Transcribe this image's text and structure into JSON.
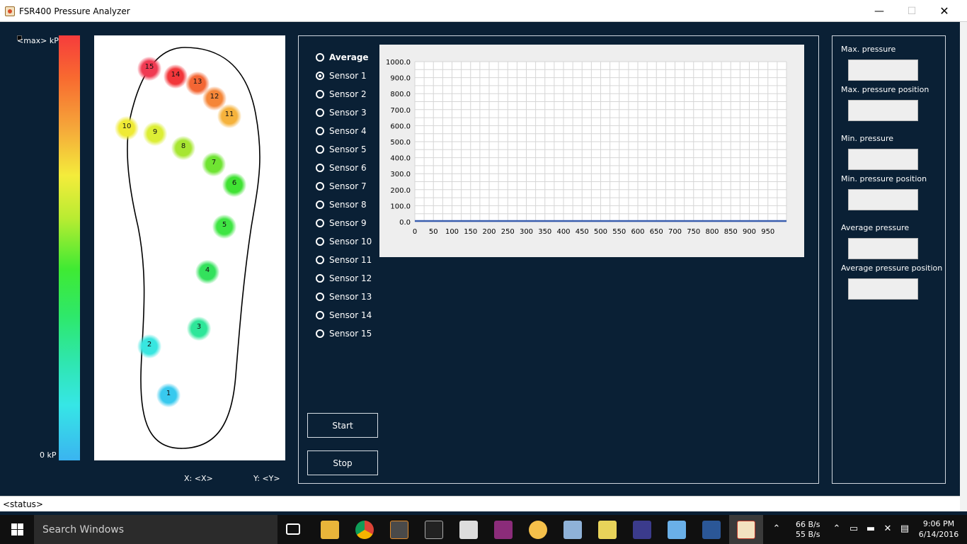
{
  "window": {
    "title": "FSR400 Pressure Analyzer",
    "minimize": "—",
    "maximize": "☐",
    "close": "✕"
  },
  "scale": {
    "max_label": "<max>  kP",
    "min_label": "0 kP"
  },
  "foot": {
    "sensors": [
      {
        "id": "1",
        "color": "#38c9ee"
      },
      {
        "id": "2",
        "color": "#38e6e0"
      },
      {
        "id": "3",
        "color": "#2ee699"
      },
      {
        "id": "4",
        "color": "#33e15c"
      },
      {
        "id": "5",
        "color": "#3fe543"
      },
      {
        "id": "6",
        "color": "#40e233"
      },
      {
        "id": "7",
        "color": "#6fe432"
      },
      {
        "id": "8",
        "color": "#a7e632"
      },
      {
        "id": "9",
        "color": "#dcee35"
      },
      {
        "id": "10",
        "color": "#efea35"
      },
      {
        "id": "11",
        "color": "#f5b23c"
      },
      {
        "id": "12",
        "color": "#f58638"
      },
      {
        "id": "13",
        "color": "#f36634"
      },
      {
        "id": "14",
        "color": "#f2363a"
      },
      {
        "id": "15",
        "color": "#f03a52"
      }
    ],
    "coord_x": "X:   <X>",
    "coord_y": "Y:  <Y>"
  },
  "radio_options": [
    {
      "label": "Average",
      "checked": false,
      "bold": true
    },
    {
      "label": "Sensor 1",
      "checked": true
    },
    {
      "label": "Sensor 2",
      "checked": false
    },
    {
      "label": "Sensor 3",
      "checked": false
    },
    {
      "label": "Sensor 4",
      "checked": false
    },
    {
      "label": "Sensor 5",
      "checked": false
    },
    {
      "label": "Sensor 6",
      "checked": false
    },
    {
      "label": "Sensor 7",
      "checked": false
    },
    {
      "label": "Sensor 8",
      "checked": false
    },
    {
      "label": "Sensor 9",
      "checked": false
    },
    {
      "label": "Sensor 10",
      "checked": false
    },
    {
      "label": "Sensor 11",
      "checked": false
    },
    {
      "label": "Sensor 12",
      "checked": false
    },
    {
      "label": "Sensor 13",
      "checked": false
    },
    {
      "label": "Sensor 14",
      "checked": false
    },
    {
      "label": "Sensor 15",
      "checked": false
    }
  ],
  "buttons": {
    "start": "Start",
    "stop": "Stop"
  },
  "chart_data": {
    "type": "line",
    "title": "",
    "xlabel": "",
    "ylabel": "",
    "xlim": [
      0,
      1000
    ],
    "ylim": [
      0,
      1000
    ],
    "x_ticks": [
      0,
      50,
      100,
      150,
      200,
      250,
      300,
      350,
      400,
      450,
      500,
      550,
      600,
      650,
      700,
      750,
      800,
      850,
      900,
      950
    ],
    "y_ticks": [
      "0.0",
      "100.0",
      "200.0",
      "300.0",
      "400.0",
      "500.0",
      "600.0",
      "700.0",
      "800.0",
      "900.0",
      "1000.0"
    ],
    "grid": true,
    "series": [
      {
        "x": [
          0,
          1000
        ],
        "y": [
          0,
          0
        ],
        "color": "#3a5fb0"
      }
    ]
  },
  "stats": {
    "max_pressure": "Max. pressure",
    "max_pressure_position": "Max. pressure position",
    "min_pressure": "Min. pressure",
    "min_pressure_position": "Min. pressure position",
    "average_pressure": "Average pressure",
    "average_pressure_position": "Average pressure position"
  },
  "status": "<status>",
  "taskbar": {
    "search_placeholder": "Search Windows",
    "net_up": "66 B/s",
    "net_down": "55 B/s",
    "time": "9:06 PM",
    "date": "6/14/2016"
  }
}
